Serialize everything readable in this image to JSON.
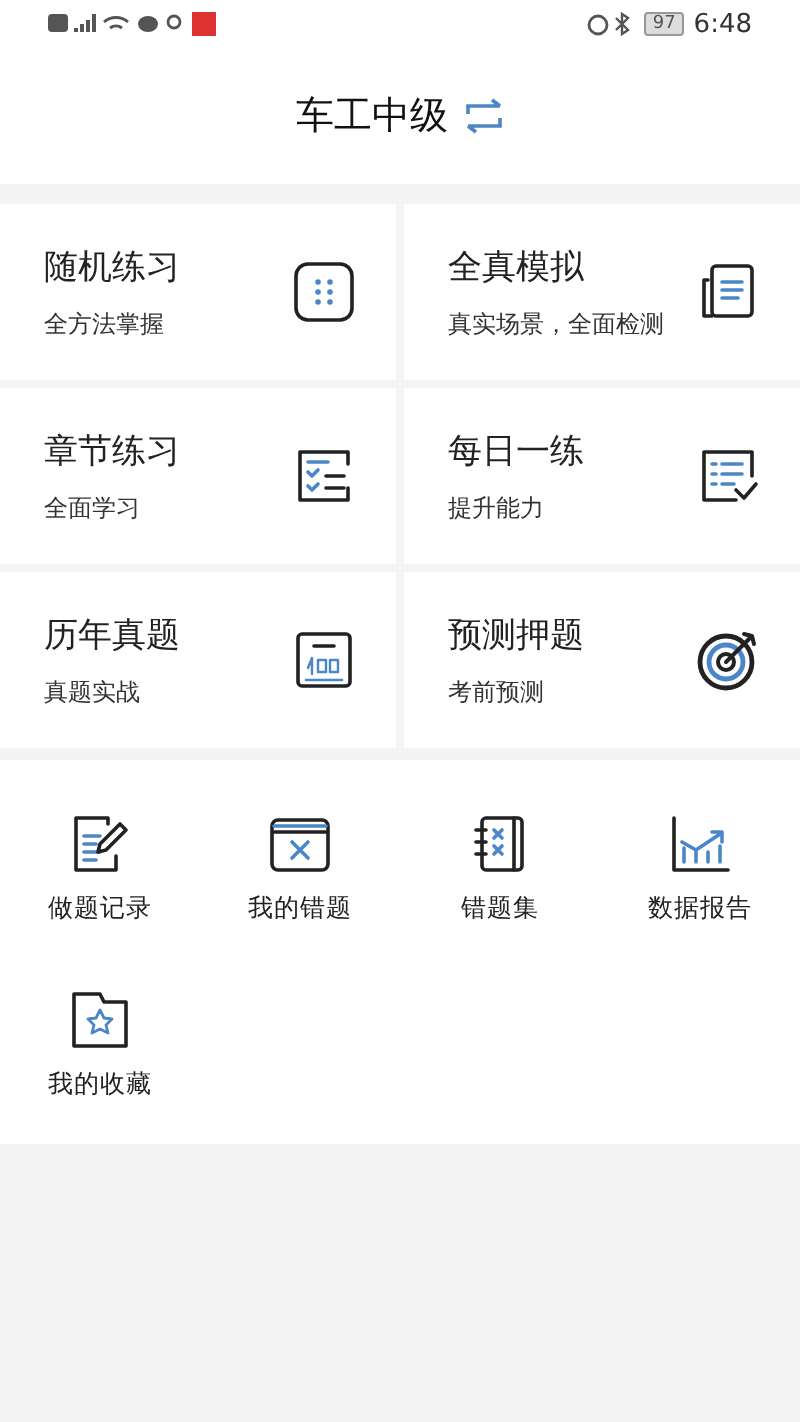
{
  "status_bar": {
    "battery": "97",
    "time": "6:48"
  },
  "header": {
    "title": "车工中级"
  },
  "modes": [
    {
      "title": "随机练习",
      "subtitle": "全方法掌握"
    },
    {
      "title": "全真模拟",
      "subtitle": "真实场景，全面检测"
    },
    {
      "title": "章节练习",
      "subtitle": "全面学习"
    },
    {
      "title": "每日一练",
      "subtitle": "提升能力"
    },
    {
      "title": "历年真题",
      "subtitle": "真题实战"
    },
    {
      "title": "预测押题",
      "subtitle": "考前预测"
    }
  ],
  "tools": [
    {
      "label": "做题记录"
    },
    {
      "label": "我的错题"
    },
    {
      "label": "错题集"
    },
    {
      "label": "数据报告"
    },
    {
      "label": "我的收藏"
    }
  ]
}
